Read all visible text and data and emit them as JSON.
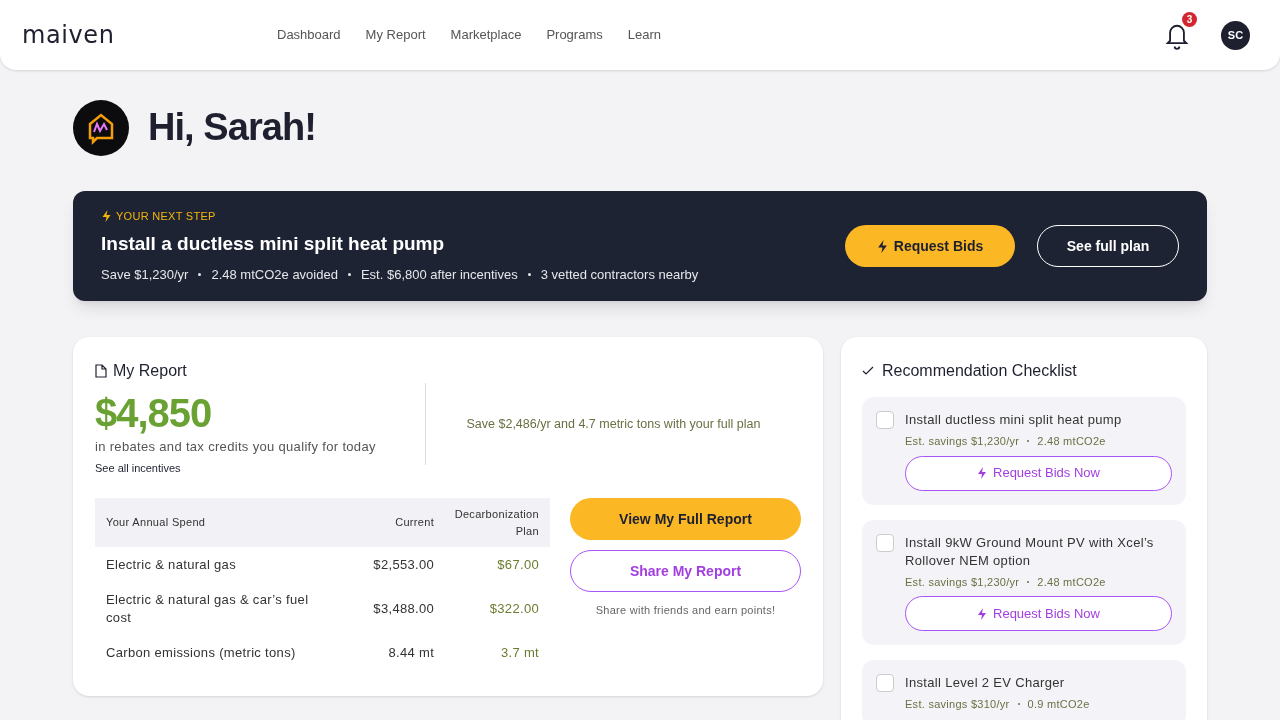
{
  "header": {
    "logo": "maiven",
    "nav": [
      {
        "label": "Dashboard"
      },
      {
        "label": "My Report"
      },
      {
        "label": "Marketplace"
      },
      {
        "label": "Programs"
      },
      {
        "label": "Learn"
      }
    ],
    "notifications": "3",
    "avatar": "SC"
  },
  "greeting": "Hi, Sarah!",
  "next_step": {
    "eyebrow": "YOUR NEXT STEP",
    "title": "Install a ductless mini split heat pump",
    "facts": [
      "Save $1,230/yr",
      "2.48 mtCO2e avoided",
      "Est. $6,800 after incentives",
      "3 vetted contractors nearby"
    ],
    "primary": "Request Bids",
    "secondary": "See full plan"
  },
  "report": {
    "title": "My Report",
    "amount": "$4,850",
    "amount_caption": "in rebates and tax credits you qualify for today",
    "link": "See all incentives",
    "plan_note": "Save $2,486/yr and 4.7 metric tons with your full plan",
    "table": {
      "columns": [
        "Your Annual Spend",
        "Current",
        "Decarbonization Plan"
      ],
      "rows": [
        [
          "Electric & natural gas",
          "$2,553.00",
          "$67.00"
        ],
        [
          "Electric & natural gas & car’s fuel cost",
          "$3,488.00",
          "$322.00"
        ],
        [
          "Carbon emissions (metric tons)",
          "8.44 mt",
          "3.7 mt"
        ]
      ]
    },
    "primary": "View My Full Report",
    "secondary": "Share My Report",
    "share_note": "Share with friends and earn points!"
  },
  "checklist": {
    "title": "Recommendation Checklist",
    "items": [
      {
        "title": "Install ductless mini split heat pump",
        "savings": "Est. savings $1,230/yr",
        "carbon": "2.48 mtCO2e",
        "checked": false,
        "button": "Request Bids Now"
      },
      {
        "title": "Install 9kW Ground Mount PV with Xcel’s Rollover NEM option",
        "savings": "Est. savings $1,230/yr",
        "carbon": "2.48 mtCO2e",
        "checked": false,
        "button": "Request Bids Now"
      },
      {
        "title": "Install Level 2 EV Charger",
        "savings": "Est. savings $310/yr",
        "carbon": "0.9 mtCO2e",
        "checked": false
      }
    ]
  }
}
